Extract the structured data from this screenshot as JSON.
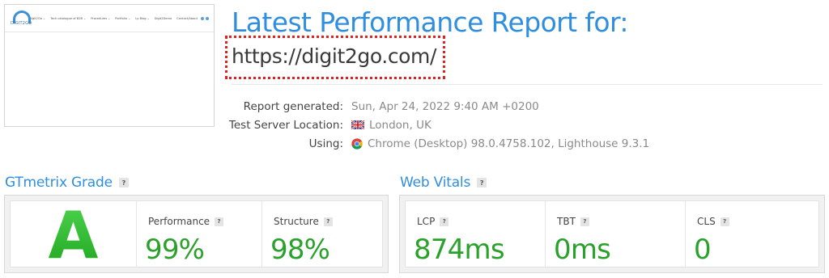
{
  "thumbnail": {
    "logo_text": "DIGIT2GO",
    "menu": [
      "Digit2Go ⌄",
      "Tech catalogue of B2B ⌄",
      "Procedures ⌄",
      "Portfolio ⌄",
      "Lp Blog ⌄",
      "Digit2Demo",
      "Contact/About"
    ]
  },
  "header": {
    "title": "Latest Performance Report for:",
    "url": "https://digit2go.com/"
  },
  "meta": {
    "generated_label": "Report generated:",
    "generated_value": "Sun, Apr 24, 2022 9:40 AM +0200",
    "location_label": "Test Server Location:",
    "location_value": "London, UK",
    "location_icon": "uk-flag-icon",
    "using_label": "Using:",
    "using_value": "Chrome (Desktop) 98.0.4758.102, Lighthouse 9.3.1",
    "using_icon": "chrome-icon"
  },
  "grade_section": {
    "title": "GTmetrix Grade",
    "help": "?",
    "grade": "A",
    "performance_label": "Performance",
    "performance_value": "99%",
    "structure_label": "Structure",
    "structure_value": "98%"
  },
  "vitals_section": {
    "title": "Web Vitals",
    "help": "?",
    "lcp_label": "LCP",
    "lcp_value": "874ms",
    "tbt_label": "TBT",
    "tbt_value": "0ms",
    "cls_label": "CLS",
    "cls_value": "0"
  },
  "colors": {
    "accent_blue": "#2f8ee0",
    "good_green": "#2aa12a",
    "highlight_red": "#e0201e"
  }
}
